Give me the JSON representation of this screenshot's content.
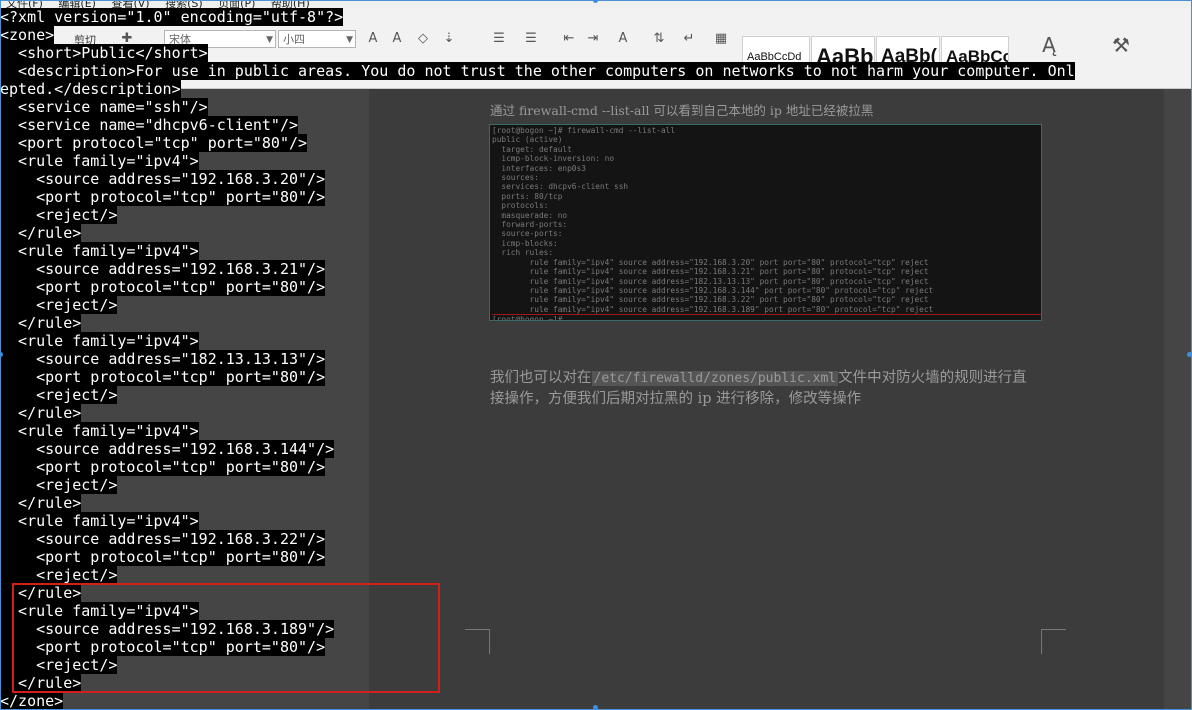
{
  "word": {
    "menu": [
      "文件(F)",
      "编辑(E)",
      "查看(V)",
      "搜索(S)",
      "页面(P)",
      "帮助(H)"
    ],
    "ribbon": {
      "cut_label": "剪切",
      "font_name": "宋体",
      "font_size": "小四",
      "styles": [
        "AaBbCcDd",
        "AaBb",
        "AaBb(",
        "AaBbCc"
      ]
    },
    "doc_text1": "通过 firewall-cmd --list-all  可以看到自己本地的 ip 地址已经被拉黑",
    "terminal_lines": [
      "[root@bogon ~]# firewall-cmd --list-all",
      "public (active)",
      "  target: default",
      "  icmp-block-inversion: no",
      "  interfaces: enp0s3",
      "  sources:",
      "  services: dhcpv6-client ssh",
      "  ports: 80/tcp",
      "  protocols:",
      "  masquerade: no",
      "  forward-ports:",
      "  source-ports:",
      "  icmp-blocks:",
      "  rich rules:",
      "        rule family=\"ipv4\" source address=\"192.168.3.20\" port port=\"80\" protocol=\"tcp\" reject",
      "        rule family=\"ipv4\" source address=\"192.168.3.21\" port port=\"80\" protocol=\"tcp\" reject",
      "        rule family=\"ipv4\" source address=\"182.13.13.13\" port port=\"80\" protocol=\"tcp\" reject",
      "        rule family=\"ipv4\" source address=\"192.168.3.144\" port port=\"80\" protocol=\"tcp\" reject",
      "        rule family=\"ipv4\" source address=\"192.168.3.22\" port port=\"80\" protocol=\"tcp\" reject",
      "        rule family=\"ipv4\" source address=\"192.168.3.189\" port port=\"80\" protocol=\"tcp\" reject",
      "[root@bogon ~]# "
    ],
    "para_before_path": "我们也可以对在",
    "para_path": "/etc/firewalld/zones/public.xml",
    "para_after_path": "文件中对防火墙的规则进行直接操作，方便我们后期对拉黑的 ip 进行移除，修改等操作"
  },
  "xml_lines": [
    "<?xml version=\"1.0\" encoding=\"utf-8\"?>",
    "<zone>",
    "  <short>Public</short>",
    "  <description>For use in public areas. You do not trust the other computers on networks to not harm your computer. Onl",
    "epted.</description>",
    "  <service name=\"ssh\"/>",
    "  <service name=\"dhcpv6-client\"/>",
    "  <port protocol=\"tcp\" port=\"80\"/>",
    "  <rule family=\"ipv4\">",
    "    <source address=\"192.168.3.20\"/>",
    "    <port protocol=\"tcp\" port=\"80\"/>",
    "    <reject/>",
    "  </rule>",
    "  <rule family=\"ipv4\">",
    "    <source address=\"192.168.3.21\"/>",
    "    <port protocol=\"tcp\" port=\"80\"/>",
    "    <reject/>",
    "  </rule>",
    "  <rule family=\"ipv4\">",
    "    <source address=\"182.13.13.13\"/>",
    "    <port protocol=\"tcp\" port=\"80\"/>",
    "    <reject/>",
    "  </rule>",
    "  <rule family=\"ipv4\">",
    "    <source address=\"192.168.3.144\"/>",
    "    <port protocol=\"tcp\" port=\"80\"/>",
    "    <reject/>",
    "  </rule>",
    "  <rule family=\"ipv4\">",
    "    <source address=\"192.168.3.22\"/>",
    "    <port protocol=\"tcp\" port=\"80\"/>",
    "    <reject/>",
    "  </rule>",
    "  <rule family=\"ipv4\">",
    "    <source address=\"192.168.3.189\"/>",
    "    <port protocol=\"tcp\" port=\"80\"/>",
    "    <reject/>",
    "  </rule>",
    "</zone>"
  ],
  "colors": {
    "highlight_box": "#d0201a",
    "xml_text": "#ffffff",
    "xml_background": "#000000",
    "selection_handle": "#3b8fe0"
  }
}
